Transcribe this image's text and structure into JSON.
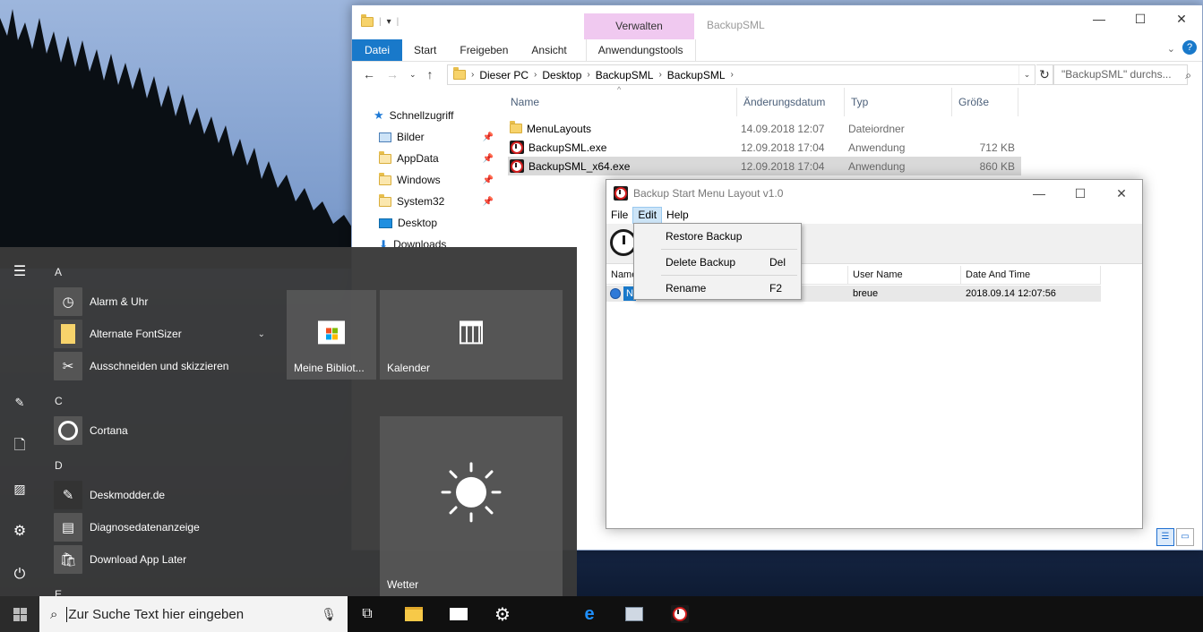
{
  "explorer": {
    "title": "BackupSML",
    "context_tab_group": "Verwalten",
    "ribbon_tabs": [
      "Datei",
      "Start",
      "Freigeben",
      "Ansicht",
      "Anwendungstools"
    ],
    "breadcrumb": [
      "Dieser PC",
      "Desktop",
      "BackupSML",
      "BackupSML"
    ],
    "search_placeholder": "\"BackupSML\" durchs...",
    "nav_pane": {
      "quick_access": "Schnellzugriff",
      "items": [
        "Bilder",
        "AppData",
        "Windows",
        "System32",
        "Desktop",
        "Downloads"
      ]
    },
    "columns": [
      "Name",
      "Änderungsdatum",
      "Typ",
      "Größe"
    ],
    "files": [
      {
        "name": "MenuLayouts",
        "date": "14.09.2018 12:07",
        "type": "Dateiordner",
        "size": ""
      },
      {
        "name": "BackupSML.exe",
        "date": "12.09.2018 17:04",
        "type": "Anwendung",
        "size": "712 KB"
      },
      {
        "name": "BackupSML_x64.exe",
        "date": "12.09.2018 17:04",
        "type": "Anwendung",
        "size": "860 KB"
      }
    ]
  },
  "backup_app": {
    "title": "Backup Start Menu Layout v1.0",
    "menu": [
      "File",
      "Edit",
      "Help"
    ],
    "edit_menu": [
      {
        "label": "Restore Backup",
        "shortcut": ""
      },
      {
        "label": "Delete Backup",
        "shortcut": "Del"
      },
      {
        "label": "Rename",
        "shortcut": "F2"
      }
    ],
    "columns": [
      "Name",
      "User Name",
      "Date And Time"
    ],
    "rows": [
      {
        "name": "N",
        "user": "breue",
        "datetime": "2018.09.14 12:07:56"
      }
    ]
  },
  "start_menu": {
    "sections": [
      {
        "letter": "A",
        "apps": [
          "Alarm & Uhr",
          "Alternate FontSizer",
          "Ausschneiden und skizzieren"
        ]
      },
      {
        "letter": "C",
        "apps": [
          "Cortana"
        ]
      },
      {
        "letter": "D",
        "apps": [
          "Deskmodder.de",
          "Diagnosedatenanzeige",
          "Download App Later"
        ]
      },
      {
        "letter": "E",
        "apps": []
      }
    ],
    "tiles": [
      "Meine Bibliot...",
      "Kalender",
      "Wetter"
    ]
  },
  "taskbar": {
    "search_placeholder": "Zur Suche Text hier eingeben"
  }
}
